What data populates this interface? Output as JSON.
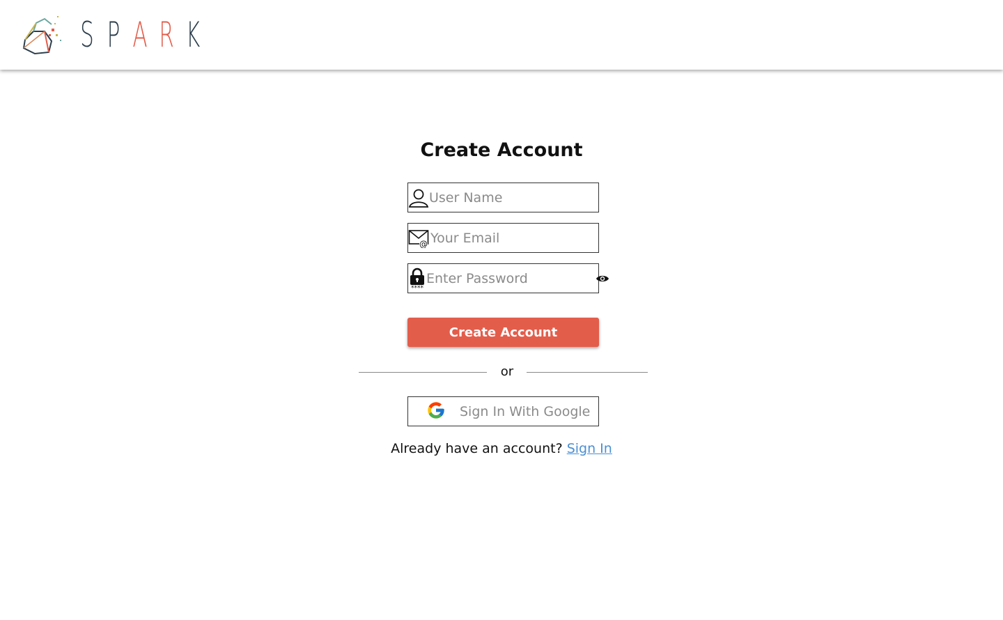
{
  "header": {
    "logo_letters": [
      "S",
      "P",
      "A",
      "R",
      "K"
    ],
    "logo_letter_colors": [
      "#2c3e4c",
      "#2c3e4c",
      "#e35d4b",
      "#e35d4b",
      "#2c3e4c"
    ]
  },
  "form": {
    "title": "Create Account",
    "username": {
      "placeholder": "User Name",
      "value": "",
      "icon": "user-icon"
    },
    "email": {
      "placeholder": "Your Email",
      "value": "",
      "icon": "mail-icon"
    },
    "password": {
      "placeholder": "Enter Password",
      "value": "",
      "icon": "lock-icon",
      "toggle_icon": "eye-icon"
    },
    "submit_label": "Create Account",
    "divider_text": "or",
    "google_label": "Sign In With Google",
    "have_account_text": "Already have an account?",
    "signin_link": "Sign In"
  },
  "colors": {
    "accent": "#e35d4b",
    "link": "#4a8fd4",
    "brand_dark": "#2c3e4c"
  }
}
